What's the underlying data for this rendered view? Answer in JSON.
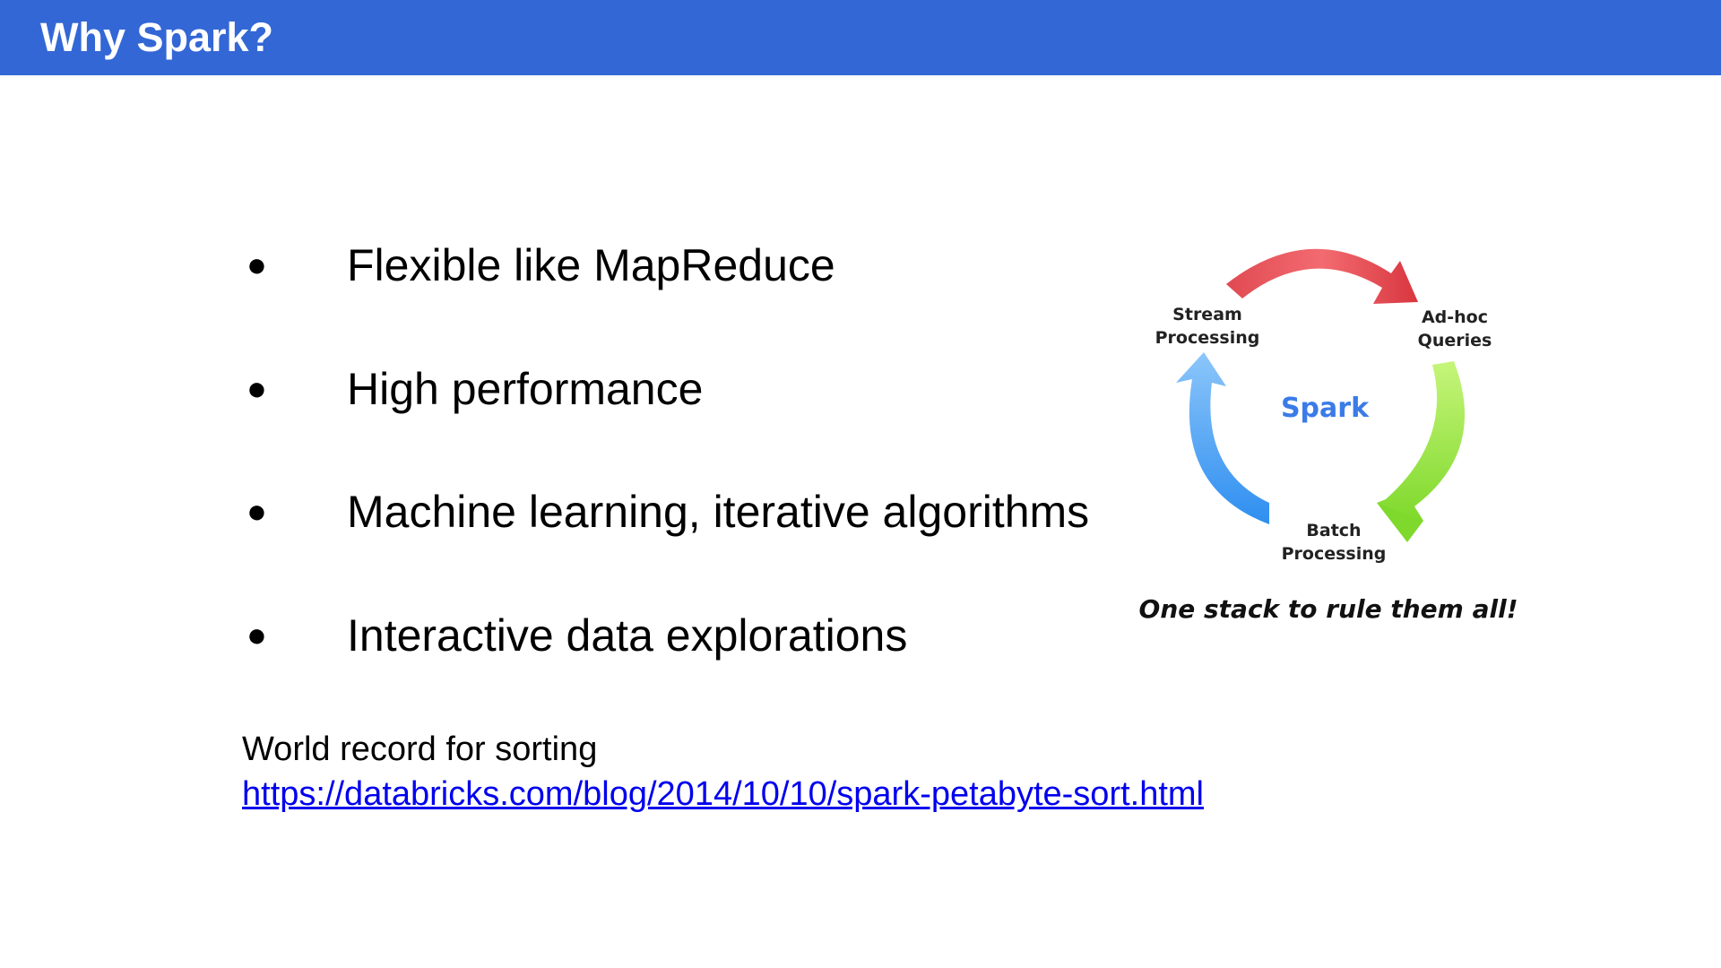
{
  "slide": {
    "title": "Why Spark?",
    "bullets": [
      "Flexible like MapReduce",
      "High performance",
      "Machine learning, iterative algorithms",
      "Interactive data explorations"
    ],
    "bullet_symbol": "●",
    "record_label": "World record for sorting",
    "record_link": "https://databricks.com/blog/2014/10/10/spark-petabyte-sort.html"
  },
  "diagram": {
    "center_label": "Spark",
    "nodes": {
      "stream": [
        "Stream",
        "Processing"
      ],
      "adhoc": [
        "Ad-hoc",
        "Queries"
      ],
      "batch": [
        "Batch",
        "Processing"
      ]
    },
    "tagline": "One stack to rule them all!",
    "colors": {
      "title_bar": "#3367d6",
      "arrow_red": "#e8474f",
      "arrow_green": "#8ee33a",
      "arrow_blue": "#4aa3f0",
      "spark_text": "#3b7be8",
      "link": "#0000ee"
    }
  }
}
